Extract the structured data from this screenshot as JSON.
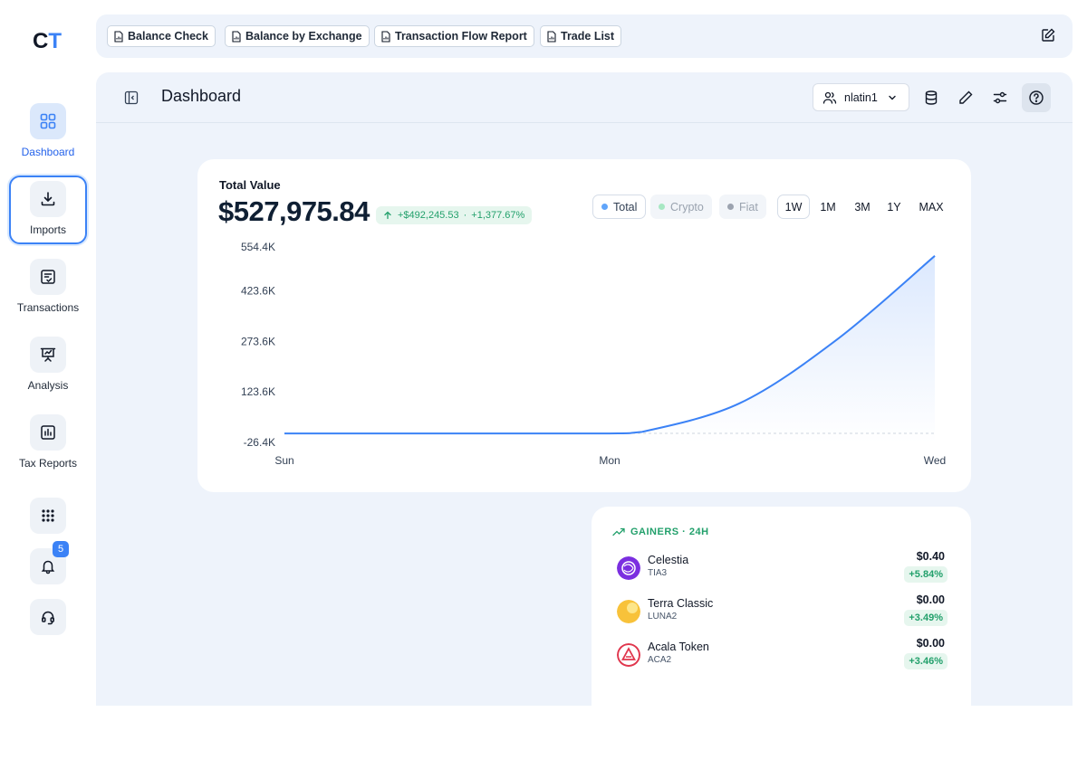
{
  "logo": {
    "c": "C",
    "t": "T"
  },
  "sidebar": {
    "items": [
      {
        "label": "Dashboard",
        "icon": "grid-icon"
      },
      {
        "label": "Imports",
        "icon": "download-icon"
      },
      {
        "label": "Transactions",
        "icon": "checklist-icon"
      },
      {
        "label": "Analysis",
        "icon": "presentation-icon"
      },
      {
        "label": "Tax Reports",
        "icon": "bar-chart-icon"
      }
    ],
    "notification_count": "5"
  },
  "topbar": {
    "chips": [
      "Balance Check",
      "Balance by Exchange",
      "Transaction Flow Report",
      "Trade List"
    ]
  },
  "header": {
    "title": "Dashboard",
    "user": "nlatin1"
  },
  "total": {
    "label": "Total Value",
    "value": "$527,975.84",
    "change_abs": "+$492,245.53",
    "change_pct": "+1,377.67%",
    "separator": "·"
  },
  "filters": {
    "series": [
      {
        "label": "Total",
        "color": "#60a5fa"
      },
      {
        "label": "Crypto",
        "color": "#86efac"
      },
      {
        "label": "Fiat",
        "color": "#9ca3af"
      }
    ],
    "ranges": [
      "1W",
      "1M",
      "3M",
      "1Y",
      "MAX"
    ],
    "selected_range": "1W"
  },
  "chart_data": {
    "type": "area",
    "x": [
      "Sun",
      "Mon",
      "Wed"
    ],
    "ylim": [
      -26.4,
      554.4
    ],
    "yticks": [
      "554.4K",
      "423.6K",
      "273.6K",
      "123.6K",
      "-26.4K"
    ],
    "ytick_values": [
      554.4,
      423.6,
      273.6,
      123.6,
      -26.4
    ],
    "series": [
      {
        "points": [
          [
            0,
            0.0
          ],
          [
            0.25,
            0.1
          ],
          [
            0.5,
            0.2
          ],
          [
            0.55,
            5
          ],
          [
            0.7,
            90
          ],
          [
            0.85,
            280
          ],
          [
            1.0,
            528.0
          ]
        ]
      }
    ],
    "color": "#3b82f6"
  },
  "gainers": {
    "title": "GAINERS · 24H",
    "items": [
      {
        "name": "Celestia",
        "symbol": "TIA3",
        "price": "$0.40",
        "pct": "+5.84%",
        "color": "#7b2fe0"
      },
      {
        "name": "Terra Classic",
        "symbol": "LUNA2",
        "price": "$0.00",
        "pct": "+3.49%",
        "color": "#f8c23a"
      },
      {
        "name": "Acala Token",
        "symbol": "ACA2",
        "price": "$0.00",
        "pct": "+3.46%",
        "color": "#e0364d"
      }
    ]
  }
}
